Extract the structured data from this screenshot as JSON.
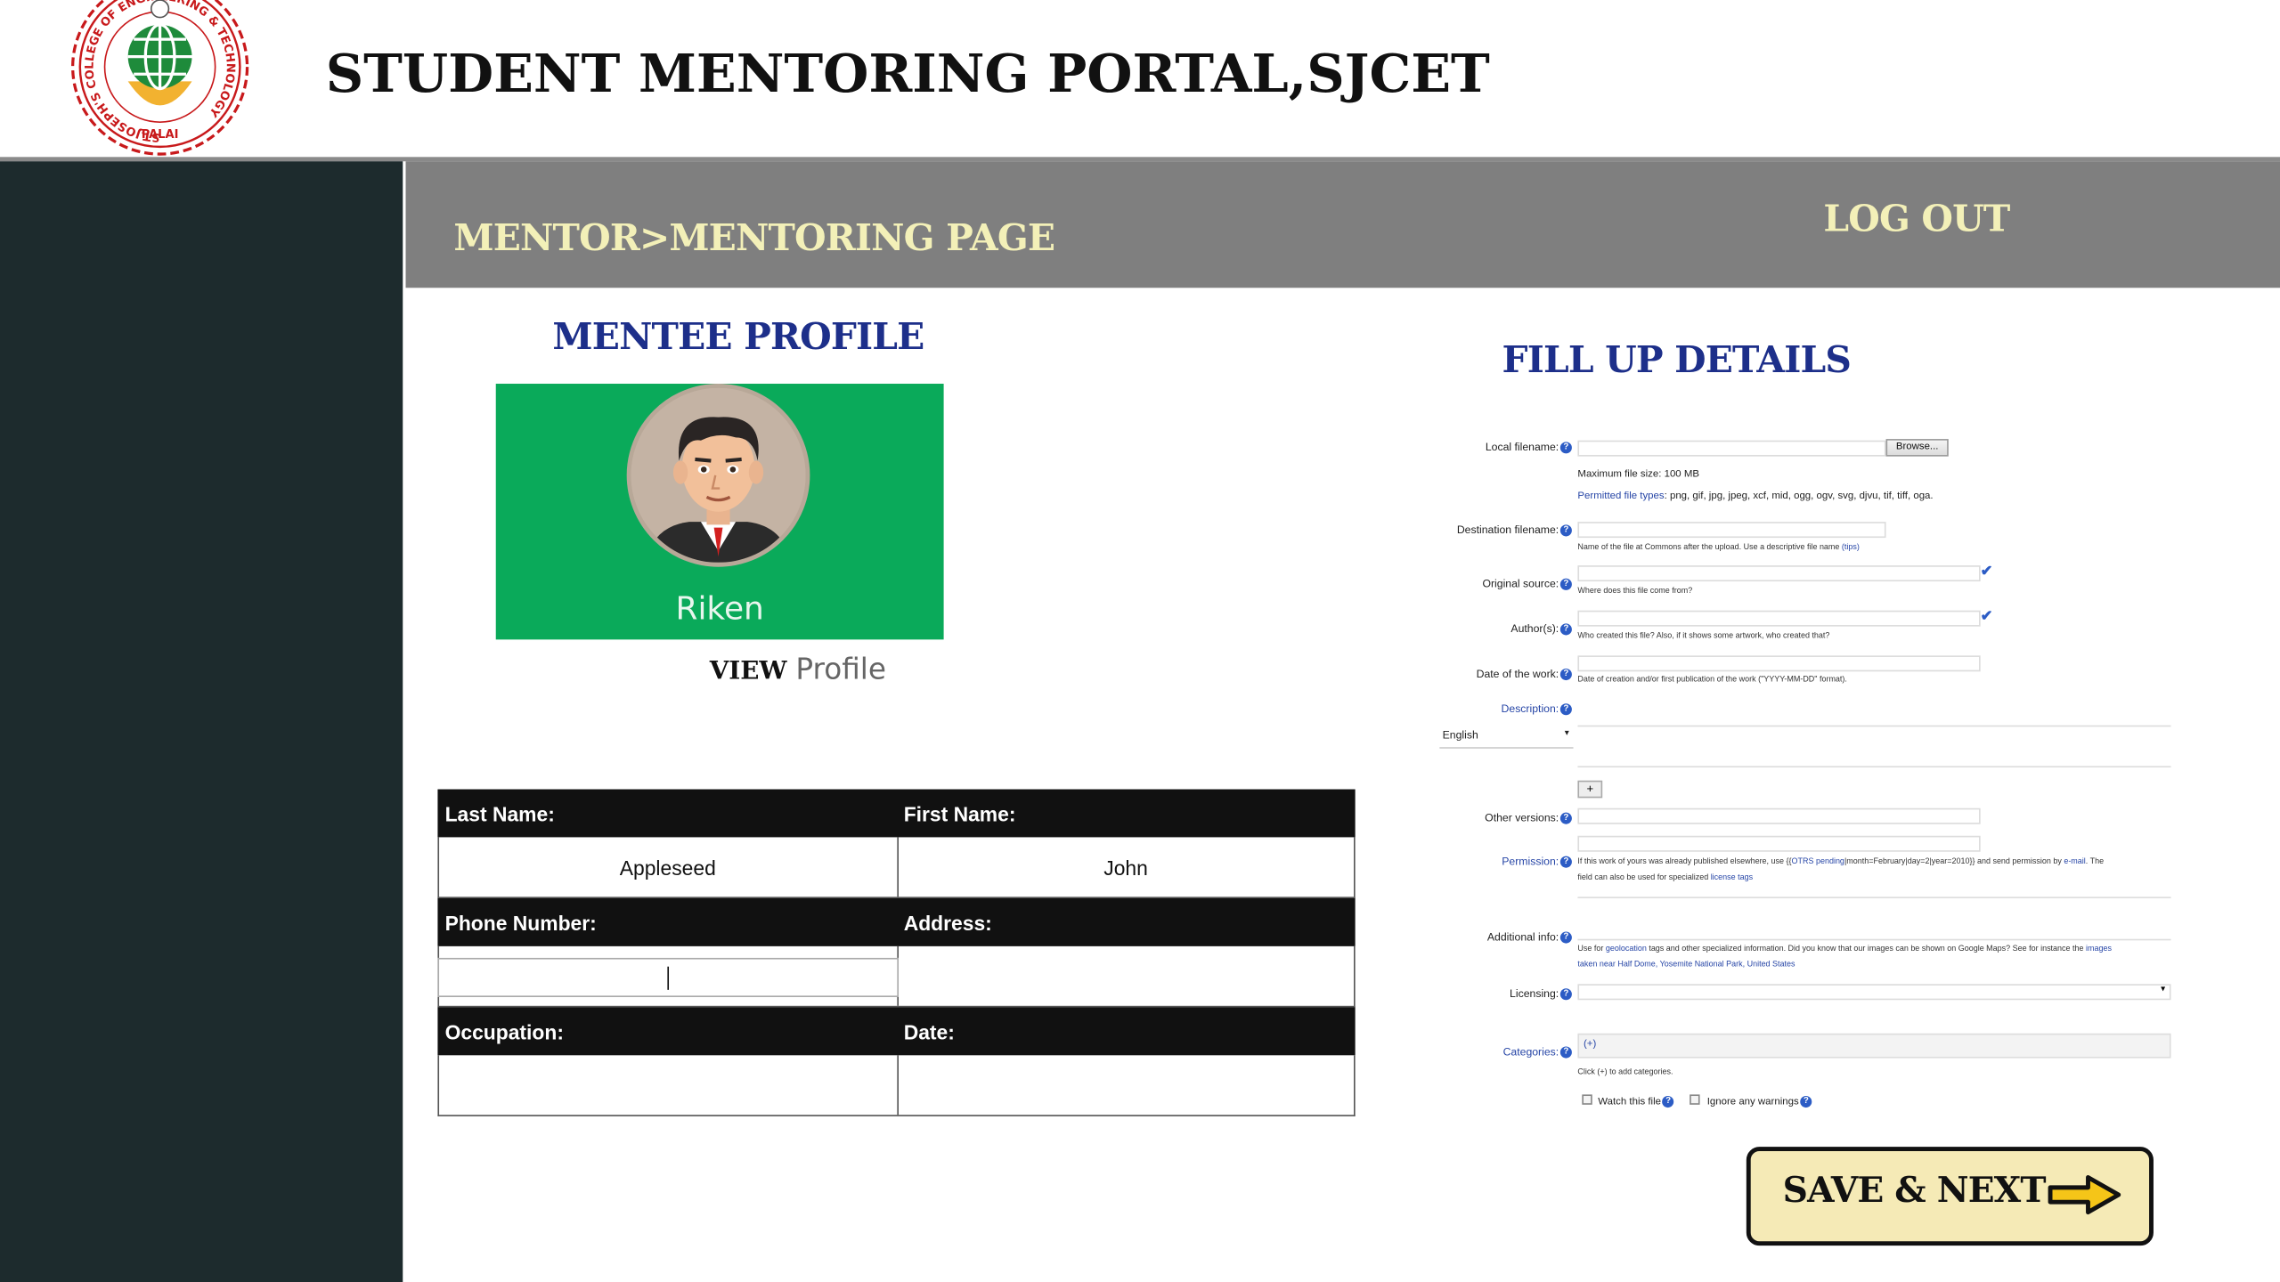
{
  "header": {
    "title": "STUDENT MENTORING PORTAL,SJCET",
    "logo": {
      "ring_text": "ST.JOSEPH'S COLLEGE OF ENGINEERING & TECHNOLOGY",
      "bottom_text": "PALAI"
    }
  },
  "topbar": {
    "breadcrumb": "MENTOR>MENTORING PAGE",
    "logout": "LOG OUT"
  },
  "mentee_profile": {
    "heading": "MENTEE PROFILE",
    "name": "Riken",
    "view_word": "VIEW",
    "profile_word": "Profile",
    "card_color": "#0aaa5a"
  },
  "mentee_table": {
    "last_name_label": "Last Name:",
    "first_name_label": "First Name:",
    "last_name": "Appleseed",
    "first_name": "John",
    "phone_label": "Phone Number:",
    "address_label": "Address:",
    "phone": "",
    "address": "",
    "occupation_label": "Occupation:",
    "date_label": "Date:",
    "occupation": "",
    "date": ""
  },
  "form": {
    "heading": "FILL UP DETAILS",
    "local_filename_label": "Local filename:",
    "browse": "Browse...",
    "max_size": "Maximum file size: 100 MB",
    "permitted_types_link": "Permitted file types",
    "permitted_types": ": png, gif, jpg, jpeg, xcf, mid, ogg, ogv, svg, djvu, tif, tiff, oga.",
    "destination_label": "Destination filename:",
    "destination_note": "Name of the file at Commons after the upload. Use a descriptive file name ",
    "destination_tips": "(tips)",
    "original_source_label": "Original source:",
    "original_source_note": "Where does this file come from?",
    "authors_label": "Author(s):",
    "authors_note": "Who created this file? Also, if it shows some artwork, who created that?",
    "date_label": "Date of the work:",
    "date_note": "Date of creation and/or first publication of the work (\"YYYY-MM-DD\" format).",
    "description_label": "Description:",
    "language": "English",
    "add_button": "+",
    "other_versions_label": "Other versions:",
    "permission_label": "Permission:",
    "permission_note_1": "If this work of yours was already published elsewhere, use {{",
    "permission_note_otrs": "OTRS pending",
    "permission_note_2": "|month=February|day=2|year=2010}} and send permission by ",
    "permission_note_email": "e-mail",
    "permission_note_3": ". The",
    "permission_note_line2": "field can also be used for specialized ",
    "permission_note_license": "license tags",
    "additional_info_label": "Additional info:",
    "additional_note_1": "Use for ",
    "additional_note_geo": "geolocation",
    "additional_note_2": " tags and other specialized information. Did you know that our images can be shown on Google Maps? See for instance the ",
    "additional_note_images": "images",
    "additional_note_line2": "taken near Half Dome, Yosemite National Park, United States",
    "licensing_label": "Licensing:",
    "categories_label": "Categories:",
    "categories_value": "(+)",
    "categories_note": "Click (+) to add categories.",
    "watch_label": "Watch this file",
    "ignore_label": "Ignore any warnings"
  },
  "save_next": "SAVE & NEXT",
  "colors": {
    "sidebar": "#1d2b2d",
    "topbar": "#7f7f7f",
    "topbar_text": "#f3f0b8",
    "heading_blue": "#1d2f8a",
    "button_fill": "#f5eab6"
  }
}
